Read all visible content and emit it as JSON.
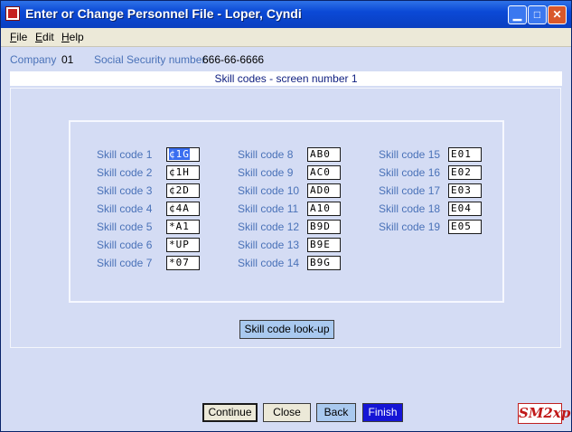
{
  "window": {
    "title": "Enter or Change Personnel File - Loper, Cyndi"
  },
  "menu": [
    {
      "label": "File",
      "accel": "F",
      "rest": "ile"
    },
    {
      "label": "Edit",
      "accel": "E",
      "rest": "dit"
    },
    {
      "label": "Help",
      "accel": "H",
      "rest": "elp"
    }
  ],
  "info": {
    "company_label": "Company",
    "company_value": "01",
    "ssn_label": "Social Security number",
    "ssn_value": "666-66-6666"
  },
  "banner": "Skill codes - screen number 1",
  "skills": [
    {
      "label": "Skill code 1",
      "value": "¢1G"
    },
    {
      "label": "Skill code 2",
      "value": "¢1H"
    },
    {
      "label": "Skill code 3",
      "value": "¢2D"
    },
    {
      "label": "Skill code 4",
      "value": "¢4A"
    },
    {
      "label": "Skill code 5",
      "value": "*A1"
    },
    {
      "label": "Skill code 6",
      "value": "*UP"
    },
    {
      "label": "Skill code 7",
      "value": "*07"
    },
    {
      "label": "Skill code 8",
      "value": "AB0"
    },
    {
      "label": "Skill code 9",
      "value": "AC0"
    },
    {
      "label": "Skill code 10",
      "value": "AD0"
    },
    {
      "label": "Skill code 11",
      "value": "A10"
    },
    {
      "label": "Skill code 12",
      "value": "B9D"
    },
    {
      "label": "Skill code 13",
      "value": "B9E"
    },
    {
      "label": "Skill code 14",
      "value": "B9G"
    },
    {
      "label": "Skill code 15",
      "value": "E01"
    },
    {
      "label": "Skill code 16",
      "value": "E02"
    },
    {
      "label": "Skill code 17",
      "value": "E03"
    },
    {
      "label": "Skill code 18",
      "value": "E04"
    },
    {
      "label": "Skill code 19",
      "value": "E05"
    }
  ],
  "buttons": {
    "lookup": "Skill code look-up",
    "continue": "Continue",
    "close": "Close",
    "back": "Back",
    "finish": "Finish"
  },
  "logo": "SM2xp"
}
